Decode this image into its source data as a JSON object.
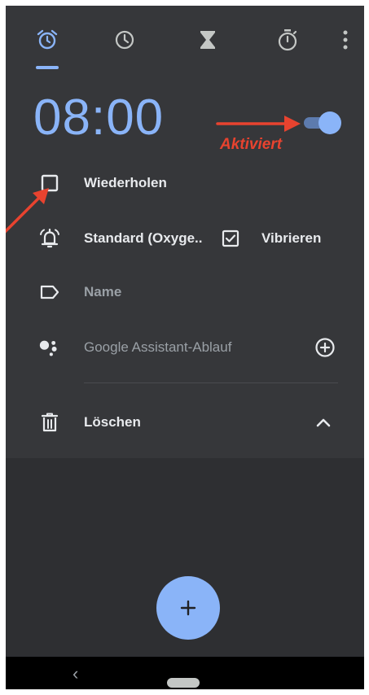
{
  "tabs": [
    {
      "name": "alarm-icon",
      "active": true
    },
    {
      "name": "clock-icon",
      "active": false
    },
    {
      "name": "timer-icon",
      "active": false
    },
    {
      "name": "stopwatch-icon",
      "active": false
    },
    {
      "name": "more-vert-icon",
      "active": false
    }
  ],
  "alarm": {
    "time": "08:00",
    "enabled": true,
    "annotation": "Aktiviert"
  },
  "options": {
    "repeat_label": "Wiederholen",
    "repeat_checked": false,
    "ringtone_label": "Standard (Oxyge..",
    "vibrate_label": "Vibrieren",
    "vibrate_checked": true,
    "name_label": "Name",
    "assistant_label": "Google Assistant-Ablauf",
    "delete_label": "Löschen"
  },
  "fab": {
    "icon": "plus-icon",
    "symbol": "+"
  },
  "navbar": {
    "back_symbol": "‹"
  },
  "colors": {
    "accent": "#8ab4f8",
    "background": "#2e2f32",
    "card": "#36373a",
    "annotation": "#e8432f",
    "text": "#e8eaed"
  }
}
